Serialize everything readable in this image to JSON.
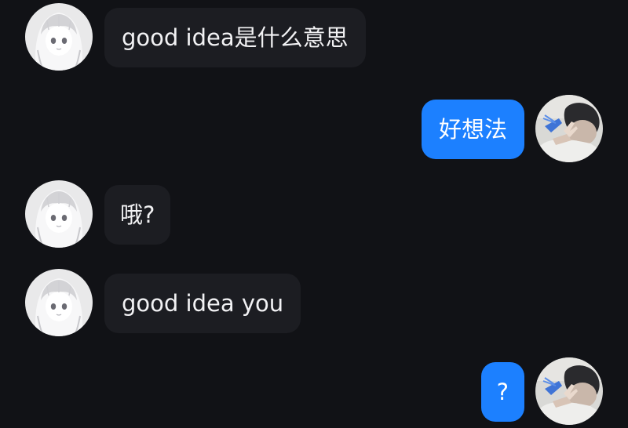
{
  "conversation": {
    "messages": [
      {
        "direction": "incoming",
        "text": "good idea是什么意思",
        "avatar": "anime-girl-avatar"
      },
      {
        "direction": "outgoing",
        "text": "好想法",
        "avatar": "boy-peace-sign-avatar"
      },
      {
        "direction": "incoming",
        "text": "哦?",
        "avatar": "anime-girl-avatar"
      },
      {
        "direction": "incoming",
        "text": "good idea you",
        "avatar": "anime-girl-avatar"
      },
      {
        "direction": "outgoing",
        "text": "?",
        "avatar": "boy-peace-sign-avatar"
      }
    ]
  },
  "colors": {
    "background": "#111216",
    "incoming_bubble": "#1c1d22",
    "outgoing_bubble": "#1c80ff",
    "text": "#f2f2f4"
  }
}
